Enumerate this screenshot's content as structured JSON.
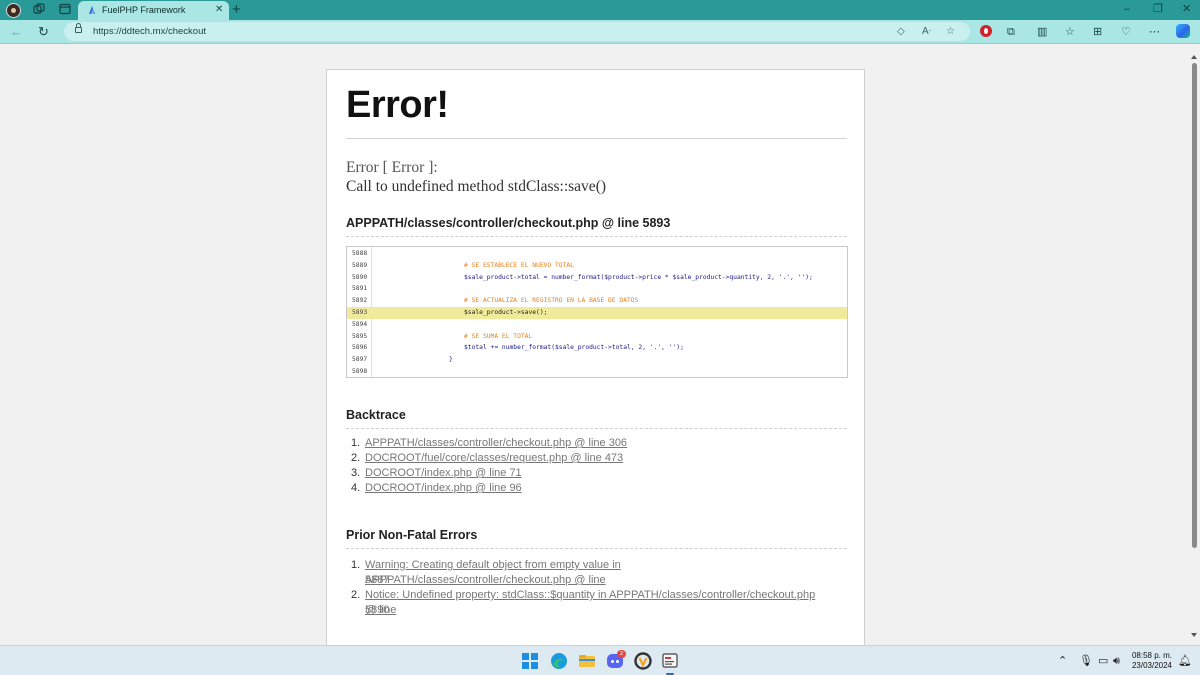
{
  "browser": {
    "tab_title": "FuelPHP Framework",
    "url": "https://ddtech.mx/checkout"
  },
  "page": {
    "title": "Error!",
    "error_type": "Error [ Error ]:",
    "error_message": "Call to undefined method stdClass::save()",
    "file_heading": "APPPATH/classes/controller/checkout.php @ line 5893",
    "code_lines": [
      {
        "num": "5888",
        "code": ""
      },
      {
        "num": "5889",
        "code": "# SE ESTABLECE EL NUEVO TOTAL"
      },
      {
        "num": "5890",
        "code": "$sale_product->total = number_format($product->price * $sale_product->quantity, 2, '.', '');"
      },
      {
        "num": "5891",
        "code": ""
      },
      {
        "num": "5892",
        "code": "# SE ACTUALIZA EL REGISTRO EN LA BASE DE DATOS"
      },
      {
        "num": "5893",
        "code": "$sale_product->save();"
      },
      {
        "num": "5894",
        "code": ""
      },
      {
        "num": "5895",
        "code": "# SE SUMA EL TOTAL"
      },
      {
        "num": "5896",
        "code": "$total += number_format($sale_product->total, 2, '.', '');"
      },
      {
        "num": "5897",
        "code": "}"
      },
      {
        "num": "5898",
        "code": ""
      }
    ],
    "highlighted_line": "5893",
    "backtrace_heading": "Backtrace",
    "backtrace": [
      {
        "num": "1.",
        "text": "APPPATH/classes/controller/checkout.php @ line 306"
      },
      {
        "num": "2.",
        "text": "DOCROOT/fuel/core/classes/request.php @ line 473"
      },
      {
        "num": "3.",
        "text": "DOCROOT/index.php @ line 71"
      },
      {
        "num": "4.",
        "text": "DOCROOT/index.php @ line 96"
      }
    ],
    "prior_heading": "Prior Non-Fatal Errors",
    "prior_errors": [
      {
        "num": "1.",
        "line1": "Warning: Creating default object from empty value in APPPATH/classes/controller/checkout.php @ line",
        "line2": "5887"
      },
      {
        "num": "2.",
        "line1": "Notice: Undefined property: stdClass::$quantity in APPPATH/classes/controller/checkout.php @ line",
        "line2": "5890"
      }
    ]
  },
  "taskbar": {
    "time": "08:58 p. m.",
    "date": "23/03/2024",
    "discord_badge": "2"
  },
  "colors": {
    "tab_strip": "#2a9a99",
    "toolbar": "#a9e6e4",
    "code_highlight": "#efeb9b",
    "code_comment": "#e8801d",
    "code_text": "#1a1a8c"
  },
  "icons": [
    "profile-avatar",
    "workspaces-icon",
    "tab-actions-icon",
    "fuelphp-favicon",
    "close-icon",
    "plus-icon",
    "minimize-icon",
    "maximize-icon",
    "back-icon",
    "refresh-icon",
    "lock-icon",
    "tag-icon",
    "read-aloud-icon",
    "star-icon",
    "opera-extension-icon",
    "extensions-icon",
    "split-screen-icon",
    "favorites-icon",
    "collections-icon",
    "browser-essentials-icon",
    "more-icon",
    "copilot-icon",
    "windows-icon",
    "edge-icon",
    "file-explorer-icon",
    "discord-icon",
    "overwatch-icon",
    "app-icon",
    "chevron-up-icon",
    "microphone-icon",
    "network-icon",
    "volume-icon",
    "notification-icon"
  ]
}
